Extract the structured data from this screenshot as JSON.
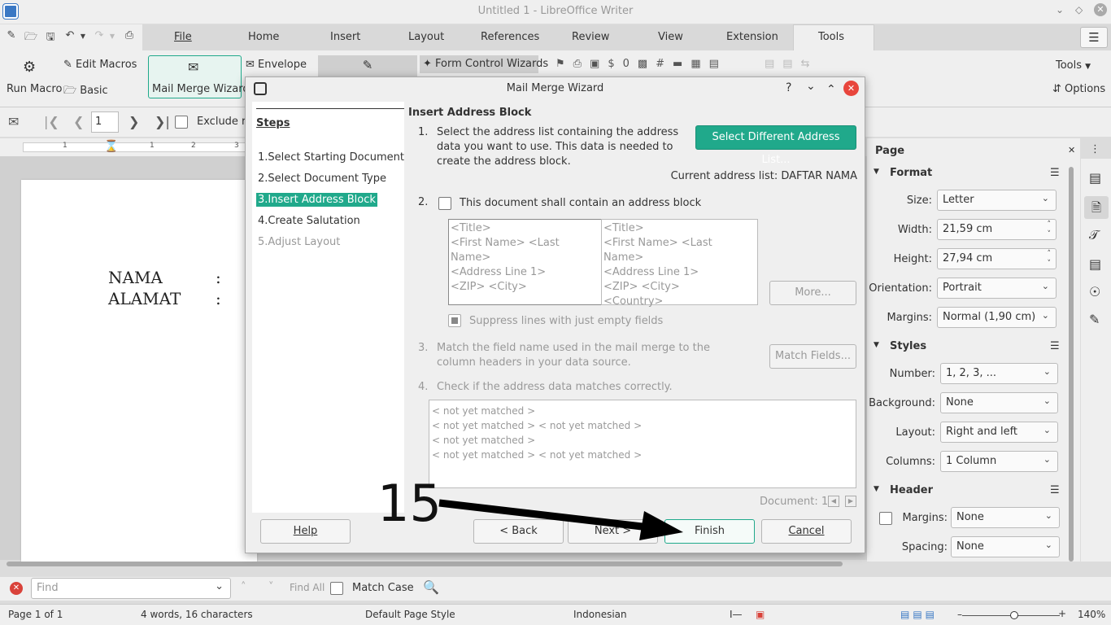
{
  "window": {
    "title": "Untitled 1 - LibreOffice Writer"
  },
  "menu": {
    "tabs": [
      "File",
      "Home",
      "Insert",
      "Layout",
      "References",
      "Review",
      "View",
      "Extension",
      "Tools"
    ]
  },
  "ribbon": {
    "edit_macros": "Edit Macros",
    "run_macro": "Run Macro",
    "basic": "Basic",
    "mail_merge_wizard": "Mail Merge Wizard",
    "envelope": "Envelope",
    "form_control_wizards": "Form Control Wizards",
    "tools_dropdown": "Tools",
    "options": "Options"
  },
  "nav": {
    "page_number": "1",
    "exclude": "Exclude re"
  },
  "document": {
    "line1_label": "NAMA",
    "line1_sep": ":",
    "line2_label": "ALAMAT",
    "line2_sep": ":"
  },
  "sidebar": {
    "panel_title": "Page",
    "format_section": "Format",
    "size_label": "Size:",
    "size_value": "Letter",
    "width_label": "Width:",
    "width_value": "21,59 cm",
    "height_label": "Height:",
    "height_value": "27,94 cm",
    "orientation_label": "Orientation:",
    "orientation_value": "Portrait",
    "margins_label": "Margins:",
    "margins_value": "Normal (1,90 cm)",
    "styles_section": "Styles",
    "number_label": "Number:",
    "number_value": "1, 2, 3, ...",
    "background_label": "Background:",
    "background_value": "None",
    "layout_label": "Layout:",
    "layout_value": "Right and left",
    "columns_label": "Columns:",
    "columns_value": "1 Column",
    "header_section": "Header",
    "header_margins_label": "Margins:",
    "header_margins_value": "None",
    "spacing_label": "Spacing:",
    "spacing_value": "None"
  },
  "findbar": {
    "placeholder": "Find",
    "find_all": "Find All",
    "match_case": "Match Case"
  },
  "status": {
    "page": "Page 1 of 1",
    "words": "4 words, 16 characters",
    "page_style": "Default Page Style",
    "language": "Indonesian",
    "zoom": "140%"
  },
  "dialog": {
    "title": "Mail Merge Wizard",
    "steps_heading": "Steps",
    "steps": [
      "1.Select Starting Document",
      "2.Select Document Type",
      "3.Insert Address Block",
      "4.Create Salutation",
      "5.Adjust Layout"
    ],
    "section_title": "Insert Address Block",
    "item1_num": "1.",
    "item1_text": "Select the address list containing the address data you want to use. This data is needed to create the address block.",
    "select_list_button": "Select Different Address List...",
    "current_list": "Current address list: DAFTAR NAMA",
    "item2_num": "2.",
    "item2_text": "This document shall contain an address block",
    "preview_left": [
      "<Title>",
      "<First Name> <Last Name>",
      "<Address Line 1>",
      "<ZIP> <City>"
    ],
    "preview_right": [
      "<Title>",
      "<First Name> <Last Name>",
      "<Address Line 1>",
      "<ZIP> <City>",
      "<Country>"
    ],
    "more_button": "More...",
    "suppress_text": "Suppress lines with just empty fields",
    "item3_num": "3.",
    "item3_text": "Match the field name used in the mail merge to the column headers in your data source.",
    "match_fields_button": "Match Fields...",
    "item4_num": "4.",
    "item4_text": "Check if the address data matches correctly.",
    "match_preview": [
      "< not yet matched >",
      "< not yet matched > < not yet matched >",
      "< not yet matched >",
      "< not yet matched > < not yet matched >"
    ],
    "document_counter": "Document: 1",
    "help_button": "Help",
    "back_button": "< Back",
    "next_button": "Next >",
    "finish_button": "Finish",
    "cancel_button": "Cancel"
  },
  "annotation": {
    "label": "15"
  },
  "colors": {
    "accent": "#20a98b",
    "close_red": "#e8453c"
  }
}
